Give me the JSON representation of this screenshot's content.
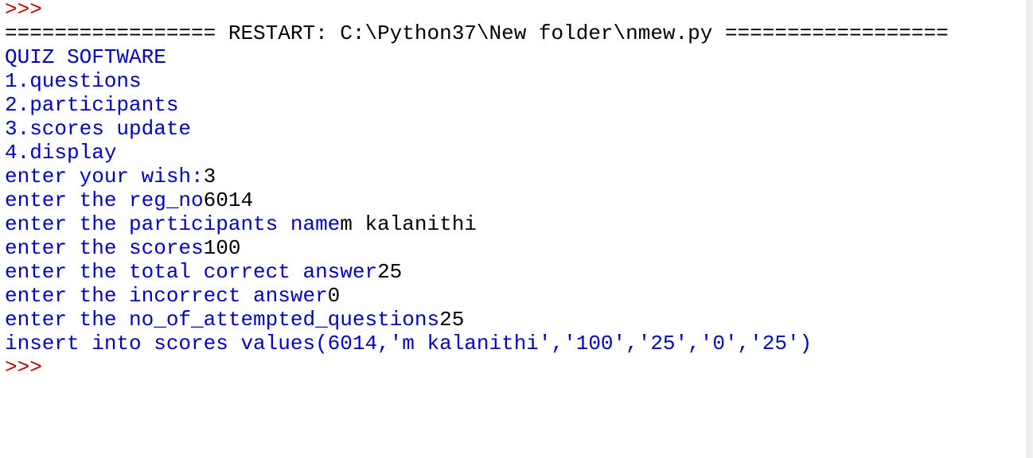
{
  "shell": {
    "prompt_top": ">>>",
    "restart_line": "================= RESTART: C:\\Python37\\New folder\\nmew.py ==================",
    "program": {
      "title": "QUIZ SOFTWARE",
      "menu": [
        "1.questions",
        "2.participants",
        "3.scores update",
        "4.display"
      ]
    },
    "interaction": [
      {
        "prompt": "enter your wish:",
        "input": "3"
      },
      {
        "prompt": "enter the reg_no",
        "input": "6014"
      },
      {
        "prompt": "enter the participants name",
        "input": "m kalanithi"
      },
      {
        "prompt": "enter the scores",
        "input": "100"
      },
      {
        "prompt": "enter the total correct answer",
        "input": "25"
      },
      {
        "prompt": "enter the incorrect answer",
        "input": "0"
      },
      {
        "prompt": "enter the no_of_attempted_questions",
        "input": "25"
      }
    ],
    "sql_output": "insert into scores values(6014,'m kalanithi','100','25','0','25')",
    "prompt_bottom": ">>>"
  },
  "colors": {
    "prompt": "#c00000",
    "output": "#0000c0",
    "input": "#000000",
    "background": "#ffffff"
  }
}
